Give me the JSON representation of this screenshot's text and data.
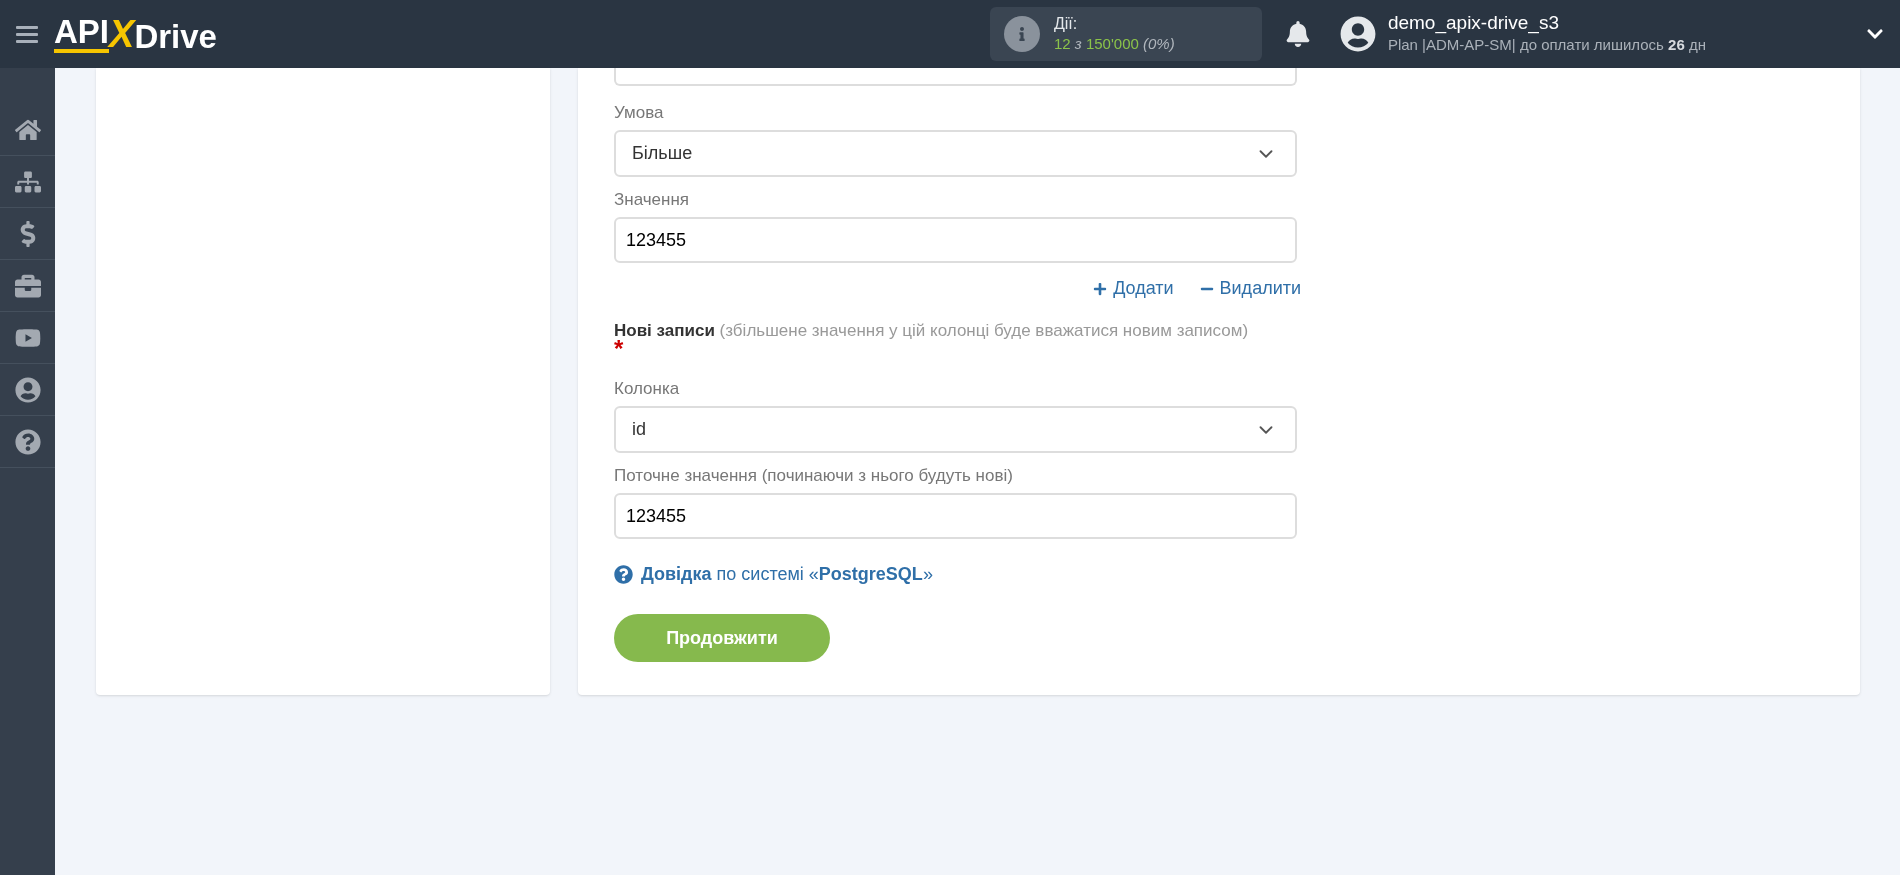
{
  "header": {
    "logo": [
      "API",
      "X",
      "Drive"
    ],
    "actions": {
      "label": "Дії:",
      "used": "12",
      "sep": "з",
      "total": "150'000",
      "percent": "(0%)"
    },
    "user": {
      "name": "demo_apix-drive_s3",
      "plan": "Plan |ADM-AP-SM| до оплати лишилось",
      "days": "26",
      "days_unit": "дн"
    }
  },
  "sidebar": {
    "items": [
      {
        "kind": "home"
      },
      {
        "kind": "sitemap"
      },
      {
        "kind": "dollar"
      },
      {
        "kind": "briefcase"
      },
      {
        "kind": "video"
      },
      {
        "kind": "user"
      },
      {
        "kind": "help"
      }
    ]
  },
  "form": {
    "condition": {
      "label": "Умова",
      "value": "Більше"
    },
    "value": {
      "label": "Значення",
      "value": "123455"
    },
    "add": "Додати",
    "remove": "Видалити",
    "new_records": {
      "title": "Нові записи",
      "hint": "(збільшене значення у цій колонці буде вважатися новим записом)",
      "required": "*"
    },
    "column": {
      "label": "Колонка",
      "value": "id"
    },
    "current": {
      "label": "Поточне значення (починаючи з нього будуть нові)",
      "value": "123455"
    },
    "help": {
      "link": "Довідка",
      "text": "по системі «",
      "system": "PostgreSQL",
      "end": "»"
    },
    "submit": "Продовжити"
  }
}
